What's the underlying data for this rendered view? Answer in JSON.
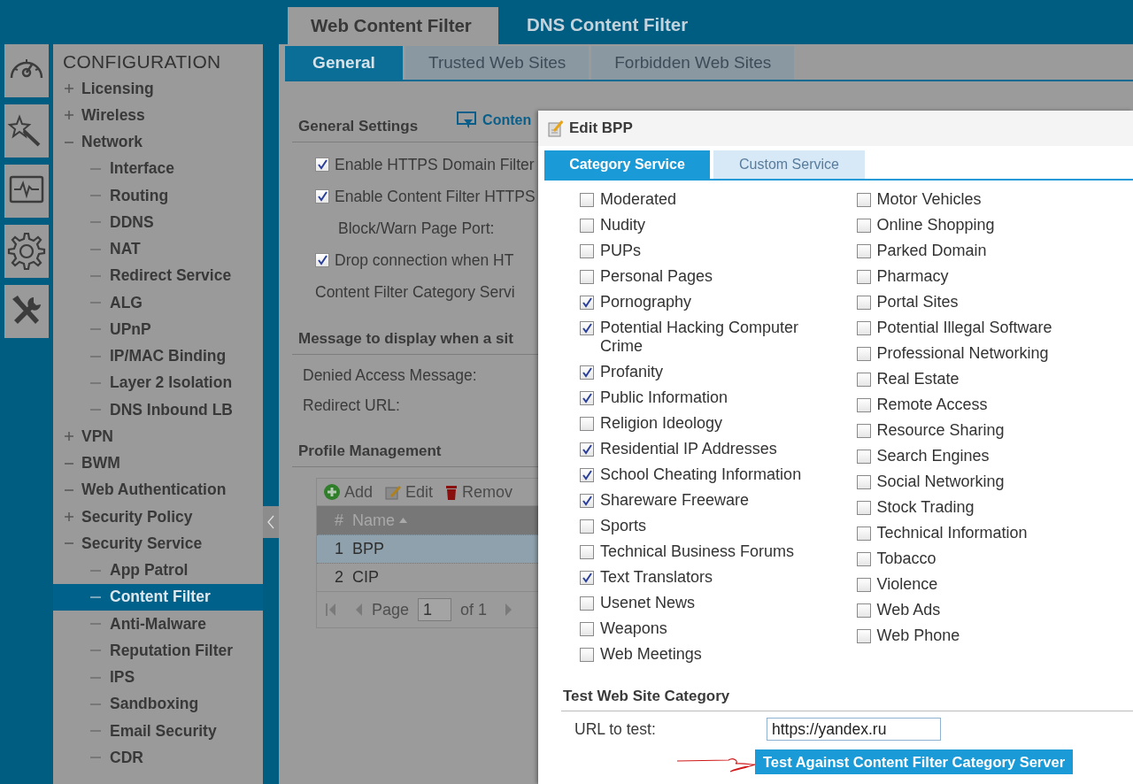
{
  "top_tabs": [
    {
      "label": "Web Content Filter",
      "selected": true
    },
    {
      "label": "DNS Content Filter",
      "selected": false
    }
  ],
  "sidebar": {
    "title": "CONFIGURATION",
    "items": [
      {
        "label": "Licensing",
        "expanded": false
      },
      {
        "label": "Wireless",
        "expanded": false
      },
      {
        "label": "Network",
        "expanded": true,
        "children": [
          {
            "label": "Interface",
            "selected": false
          },
          {
            "label": "Routing",
            "selected": false
          },
          {
            "label": "DDNS",
            "selected": false
          },
          {
            "label": "NAT",
            "selected": false
          },
          {
            "label": "Redirect Service",
            "selected": false
          },
          {
            "label": "ALG",
            "selected": false
          },
          {
            "label": "UPnP",
            "selected": false
          },
          {
            "label": "IP/MAC Binding",
            "selected": false
          },
          {
            "label": "Layer 2 Isolation",
            "selected": false
          },
          {
            "label": "DNS Inbound LB",
            "selected": false
          }
        ]
      },
      {
        "label": "VPN",
        "expanded": false
      },
      {
        "label": "BWM",
        "expanded": true
      },
      {
        "label": "Web Authentication",
        "expanded": true
      },
      {
        "label": "Security Policy",
        "expanded": false
      },
      {
        "label": "Security Service",
        "expanded": true,
        "children": [
          {
            "label": "App Patrol",
            "selected": false
          },
          {
            "label": "Content Filter",
            "selected": true
          },
          {
            "label": "Anti-Malware",
            "selected": false
          },
          {
            "label": "Reputation Filter",
            "selected": false
          },
          {
            "label": "IPS",
            "selected": false
          },
          {
            "label": "Sandboxing",
            "selected": false
          },
          {
            "label": "Email Security",
            "selected": false
          },
          {
            "label": "CDR",
            "selected": false
          }
        ]
      }
    ]
  },
  "sub_tabs": [
    {
      "label": "General",
      "selected": true
    },
    {
      "label": "Trusted Web Sites",
      "selected": false
    },
    {
      "label": "Forbidden Web Sites",
      "selected": false
    }
  ],
  "general_settings": {
    "title": "General Settings",
    "link": "Conten",
    "options": [
      {
        "kind": "checkbox",
        "label": "Enable HTTPS Domain Filter",
        "checked": true
      },
      {
        "kind": "checkbox",
        "label": "Enable Content Filter HTTPS",
        "checked": true
      },
      {
        "kind": "text",
        "label": "Block/Warn Page Port:"
      },
      {
        "kind": "checkbox",
        "label": "Drop connection when HT",
        "checked": true
      },
      {
        "kind": "plain",
        "label": "Content Filter Category Servi"
      }
    ]
  },
  "message_section": {
    "title": "Message to display when a sit",
    "fields": [
      "Denied Access Message:",
      "Redirect URL:"
    ]
  },
  "profile_management": {
    "title": "Profile Management",
    "toolbar": [
      {
        "kind": "add",
        "label": "Add"
      },
      {
        "kind": "edit",
        "label": "Edit"
      },
      {
        "kind": "remove",
        "label": "Remov"
      }
    ],
    "columns": [
      "#",
      "Name"
    ],
    "rows": [
      {
        "cells": [
          "1",
          "BPP"
        ],
        "selected": true
      },
      {
        "cells": [
          "2",
          "CIP"
        ],
        "selected": false
      }
    ],
    "pager": {
      "label": "Page",
      "value": "1",
      "total": "of 1"
    }
  },
  "dialog": {
    "title": "Edit BPP",
    "tabs": [
      {
        "label": "Category Service",
        "selected": true
      },
      {
        "label": "Custom Service",
        "selected": false
      }
    ],
    "left_column": [
      {
        "label": "Moderated",
        "checked": false
      },
      {
        "label": "Nudity",
        "checked": false
      },
      {
        "label": "PUPs",
        "checked": false
      },
      {
        "label": "Personal Pages",
        "checked": false
      },
      {
        "label": "Pornography",
        "checked": true
      },
      {
        "label": "Potential Hacking Computer Crime",
        "checked": true
      },
      {
        "label": "Profanity",
        "checked": true
      },
      {
        "label": "Public Information",
        "checked": true
      },
      {
        "label": "Religion Ideology",
        "checked": false
      },
      {
        "label": "Residential IP Addresses",
        "checked": true
      },
      {
        "label": "School Cheating Information",
        "checked": true
      },
      {
        "label": "Shareware Freeware",
        "checked": true
      },
      {
        "label": "Sports",
        "checked": false
      },
      {
        "label": "Technical Business Forums",
        "checked": false
      },
      {
        "label": "Text Translators",
        "checked": true
      },
      {
        "label": "Usenet News",
        "checked": false
      },
      {
        "label": "Weapons",
        "checked": false
      },
      {
        "label": "Web Meetings",
        "checked": false
      }
    ],
    "right_column": [
      {
        "label": "Motor Vehicles",
        "checked": false
      },
      {
        "label": "Online Shopping",
        "checked": false
      },
      {
        "label": "Parked Domain",
        "checked": false
      },
      {
        "label": "Pharmacy",
        "checked": false
      },
      {
        "label": "Portal Sites",
        "checked": false
      },
      {
        "label": "Potential Illegal Software",
        "checked": false
      },
      {
        "label": "Professional Networking",
        "checked": false
      },
      {
        "label": "Real Estate",
        "checked": false
      },
      {
        "label": "Remote Access",
        "checked": false
      },
      {
        "label": "Resource Sharing",
        "checked": false
      },
      {
        "label": "Search Engines",
        "checked": false
      },
      {
        "label": "Social Networking",
        "checked": false
      },
      {
        "label": "Stock Trading",
        "checked": false
      },
      {
        "label": "Technical Information",
        "checked": false
      },
      {
        "label": "Tobacco",
        "checked": false
      },
      {
        "label": "Violence",
        "checked": false
      },
      {
        "label": "Web Ads",
        "checked": false
      },
      {
        "label": "Web Phone",
        "checked": false
      }
    ],
    "test": {
      "title": "Test Web Site Category",
      "url_label": "URL to test:",
      "url": "https://yandex.ru",
      "button": "Test Against Content Filter Category Server"
    }
  }
}
